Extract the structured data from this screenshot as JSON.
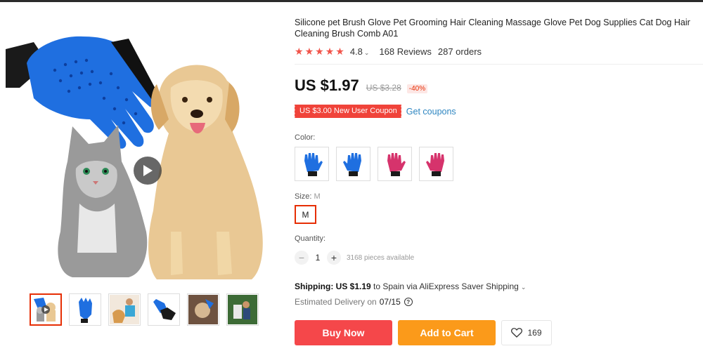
{
  "product": {
    "title": "Silicone pet Brush Glove Pet Grooming Hair Cleaning Massage Glove Pet Dog Supplies Cat Dog Hair Cleaning Brush Comb A01",
    "rating": "4.8",
    "rating_stars": 5,
    "reviews": "168 Reviews",
    "orders": "287 orders"
  },
  "price": {
    "current": "US $1.97",
    "original": "US $3.28",
    "discount": "-40%"
  },
  "coupon": {
    "label": "US $3.00 New User Coupon",
    "link": "Get coupons"
  },
  "color": {
    "label": "Color:",
    "options": [
      "blue-glove-left",
      "blue-glove-right",
      "pink-glove-left",
      "pink-glove-right"
    ]
  },
  "size": {
    "label": "Size:",
    "selected": "M",
    "option": "M"
  },
  "quantity": {
    "label": "Quantity:",
    "value": "1",
    "available": "3168 pieces available",
    "minus": "−",
    "plus": "+"
  },
  "shipping": {
    "label": "Shipping: US $1.19",
    "text": " to Spain via AliExpress Saver Shipping",
    "delivery_label": "Estimated Delivery on",
    "delivery_date": "07/15"
  },
  "actions": {
    "buy": "Buy Now",
    "cart": "Add to Cart",
    "wishlist_count": "169"
  },
  "colors": {
    "accent_red": "#f5474a",
    "cart_orange": "#fb9a1a",
    "star": "#f1544a",
    "link": "#2e86c1"
  }
}
